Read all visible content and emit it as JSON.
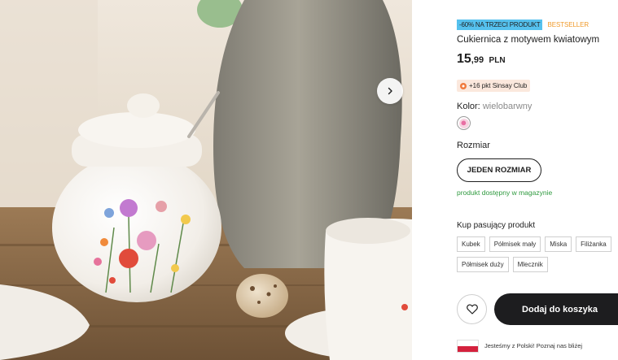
{
  "gallery": {
    "next_icon": "chevron-right-icon"
  },
  "product": {
    "promo_badge": "-60% NA TRZECI PRODUKT",
    "bestseller_badge": "BESTSELLER",
    "title": "Cukiernica z motywem kwiatowym",
    "price_main": "15",
    "price_decimal": ",99",
    "price_currency": "PLN",
    "club_points": "+16 pkt Sinsay Club",
    "color_label": "Kolor:",
    "color_value": "wielobarwny",
    "size_label": "Rozmiar",
    "size_option": "JEDEN ROZMIAR",
    "stock_status": "produkt dostępny w magazynie"
  },
  "matching": {
    "label": "Kup pasujący produkt",
    "items": [
      "Kubek",
      "Półmisek mały",
      "Miska",
      "Filiżanka",
      "Półmisek duży",
      "Mlecznik"
    ]
  },
  "actions": {
    "favorite_icon": "heart-icon",
    "add_to_cart": "Dodaj do koszyka"
  },
  "footer": {
    "poland_text": "Jesteśmy z Polski! Poznaj nas bliżej"
  },
  "colors": {
    "promo": "#55c1ee",
    "bestseller": "#f09a2a",
    "stock": "#2f9a3f",
    "cart_button": "#1d1d1f",
    "club_bg": "#fbe8dd"
  }
}
